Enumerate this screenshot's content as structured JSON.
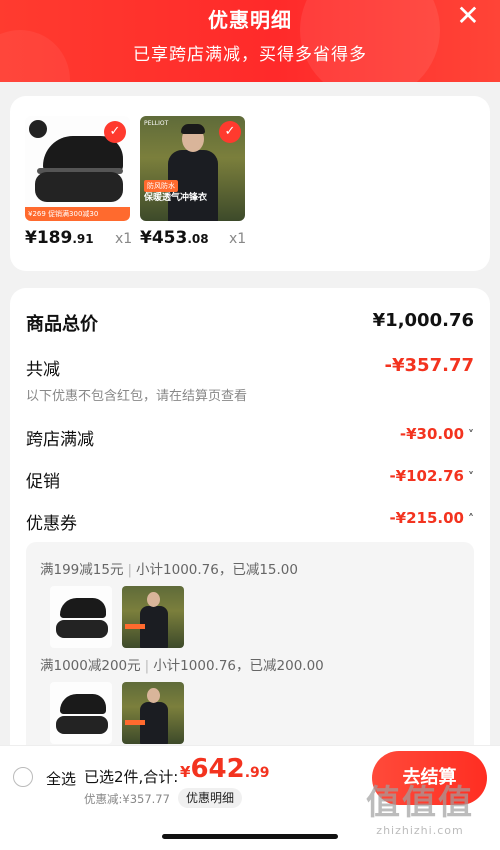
{
  "header": {
    "title": "优惠明细",
    "subtitle": "已享跨店满减，买得多省得多",
    "close_icon": "close-icon"
  },
  "products": [
    {
      "name": "shoe",
      "price_main": "¥189",
      "price_decimal": ".91",
      "qty": "x1",
      "tag": "促销满300减30",
      "tag_price": "¥269"
    },
    {
      "name": "jacket",
      "price_main": "¥453",
      "price_decimal": ".08",
      "qty": "x1",
      "brand": "PELLIOT",
      "label_top": "防风防水",
      "label": "保暖透气冲锋衣"
    }
  ],
  "summary": {
    "total_label": "商品总价",
    "total_value": "¥1,000.76",
    "discount_label": "共减",
    "discount_value": "-¥357.77",
    "note": "以下优惠不包含红包，请在结算页查看",
    "items": [
      {
        "label": "跨店满减",
        "value": "-¥30.00",
        "chevron": "˅"
      },
      {
        "label": "促销",
        "value": "-¥102.76",
        "chevron": "˅"
      },
      {
        "label": "优惠券",
        "value": "-¥215.00",
        "chevron": "˄"
      }
    ]
  },
  "coupons": [
    {
      "rule": "满199减15元",
      "detail": "小计1000.76，已减15.00"
    },
    {
      "rule": "满1000减200元",
      "detail": "小计1000.76，已减200.00"
    }
  ],
  "bottom": {
    "select_all": "全选",
    "selected": "已选2件,合计:",
    "currency": "¥",
    "amount_main": "642",
    "amount_decimal": ".99",
    "saved": "优惠减:¥357.77",
    "detail_button": "优惠明细",
    "settle_button": "去结算"
  },
  "watermark": {
    "big": "值值值",
    "small": "zhizhizhi.com"
  },
  "colors": {
    "accent": "#f3331f",
    "header_bg": "#ff3b2f"
  }
}
